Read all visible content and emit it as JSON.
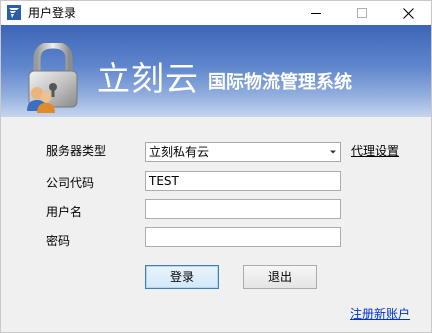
{
  "window": {
    "title": "用户登录",
    "app_icon": "app-logo-icon",
    "controls": {
      "minimize_icon": "minimize-icon",
      "maximize_icon": "maximize-icon",
      "close_icon": "close-icon"
    }
  },
  "banner": {
    "brand": "立刻云",
    "subtitle": "国际物流管理系统",
    "art_icon": "padlock-users-icon",
    "colors": {
      "gradient_top": "#3d65b7",
      "gradient_bottom": "#c7d5ef"
    }
  },
  "form": {
    "server_type_label": "服务器类型",
    "server_type_value": "立刻私有云",
    "proxy_settings_label": "代理设置",
    "company_code_label": "公司代码",
    "company_code_value": "TEST",
    "username_label": "用户名",
    "username_value": "",
    "password_label": "密码",
    "password_value": ""
  },
  "actions": {
    "login_label": "登录",
    "exit_label": "退出",
    "register_label": "注册新账户"
  },
  "colors": {
    "link_blue": "#0033cc",
    "login_border": "#3c7fb1"
  }
}
